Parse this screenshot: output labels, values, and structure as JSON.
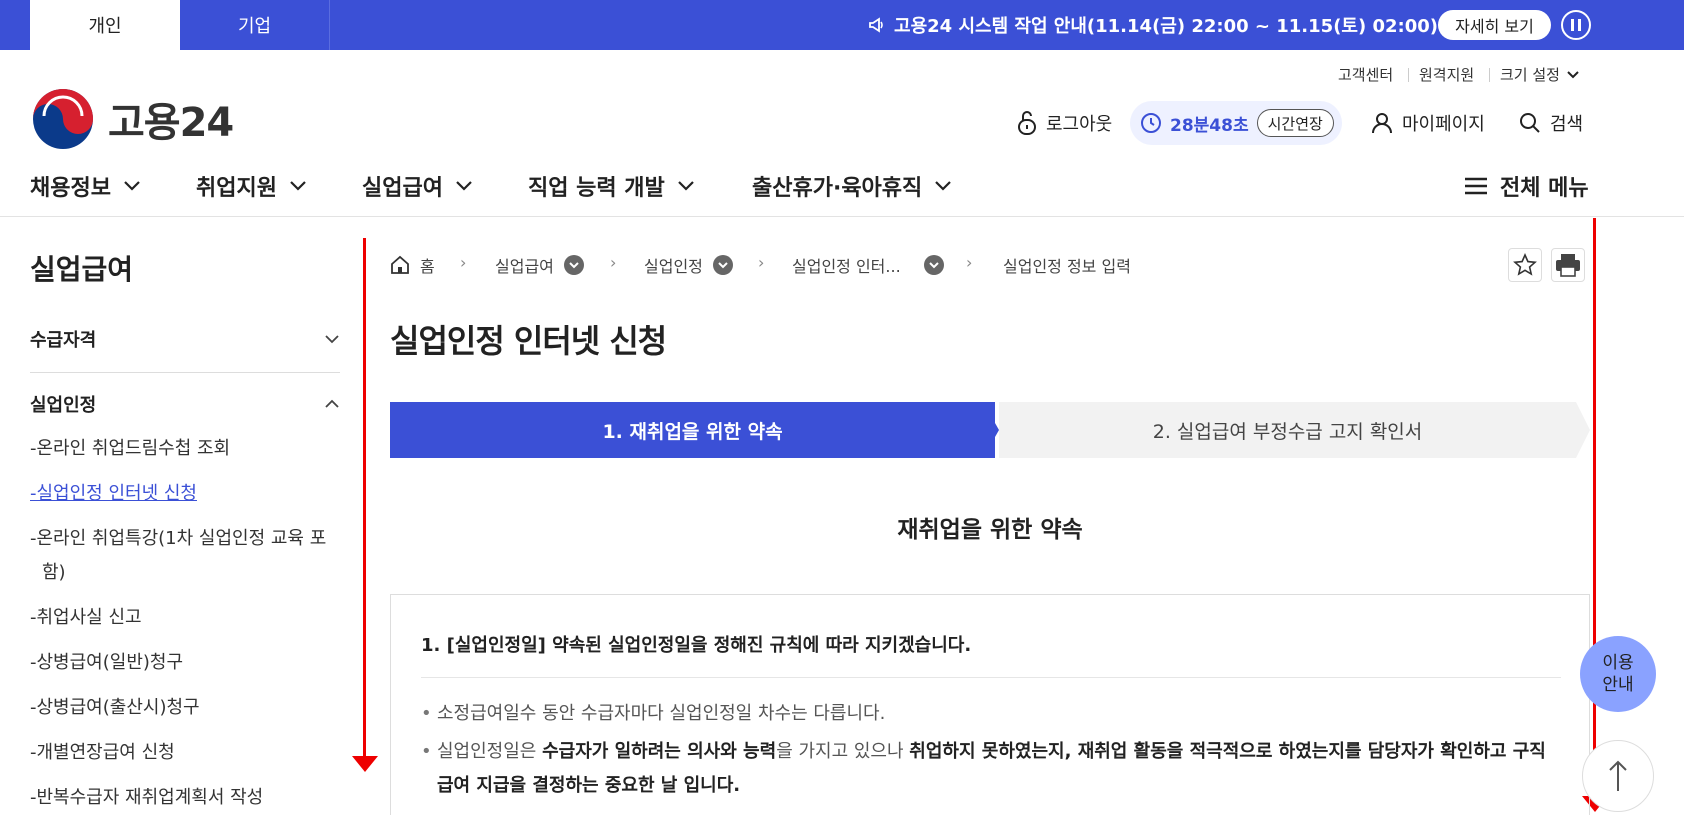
{
  "topbar": {
    "tabs": [
      "개인",
      "기업"
    ],
    "notice": "고용24 시스템 작업 안내(11.14(금) 22:00 ~ 11.15(토) 02:00)",
    "detail_label": "자세히 보기"
  },
  "utility": {
    "customer_center": "고객센터",
    "remote_support": "원격지원",
    "size_setting": "크기 설정"
  },
  "logo": {
    "text": "고용24"
  },
  "header": {
    "logout": "로그아웃",
    "timer": "28분48초",
    "extend": "시간연장",
    "mypage": "마이페이지",
    "search": "검색"
  },
  "gnb": {
    "items": [
      "채용정보",
      "취업지원",
      "실업급여",
      "직업 능력 개발",
      "출산휴가·육아휴직"
    ],
    "all_menu": "전체 메뉴"
  },
  "sidebar": {
    "title": "실업급여",
    "group1": "수급자격",
    "group2": "실업인정",
    "links": [
      "온라인 취업드림수첩 조회",
      "실업인정 인터넷 신청",
      "온라인 취업특강(1차 실업인정 교육 포함)",
      "취업사실 신고",
      "상병급여(일반)청구",
      "상병급여(출산시)청구",
      "개별연장급여 신청",
      "반복수급자 재취업계획서 작성"
    ]
  },
  "breadcrumb": [
    "홈",
    "실업급여",
    "실업인정",
    "실업인정 인터...",
    "실업인정 정보 입력"
  ],
  "page_title": "실업인정 인터넷 신청",
  "steps": [
    "1. 재취업을 위한 약속",
    "2. 실업급여 부정수급 고지 확인서"
  ],
  "section_title": "재취업을 위한 약속",
  "item1": {
    "title": "1. [실업인정일] 약속된 실업인정일을 정해진 규칙에 따라 지키겠습니다.",
    "bullet1": "소정급여일수 동안 수급자마다 실업인정일 차수는 다릅니다.",
    "bullet2_a": "실업인정일은 ",
    "bullet2_b": "수급자가 일하려는 의사와 능력",
    "bullet2_c": "을 가지고 있으나 ",
    "bullet2_d": "취업하지 못하였는지, 재취업 활동을 적극적으로 하였는지를 담당자가 확인하고 구직급여 지급을 결정하는 중요한 날 입니다."
  },
  "floating": {
    "guide": "이용\n안내"
  },
  "colors": {
    "primary": "#3b50d6",
    "annotation": "#e00000"
  }
}
